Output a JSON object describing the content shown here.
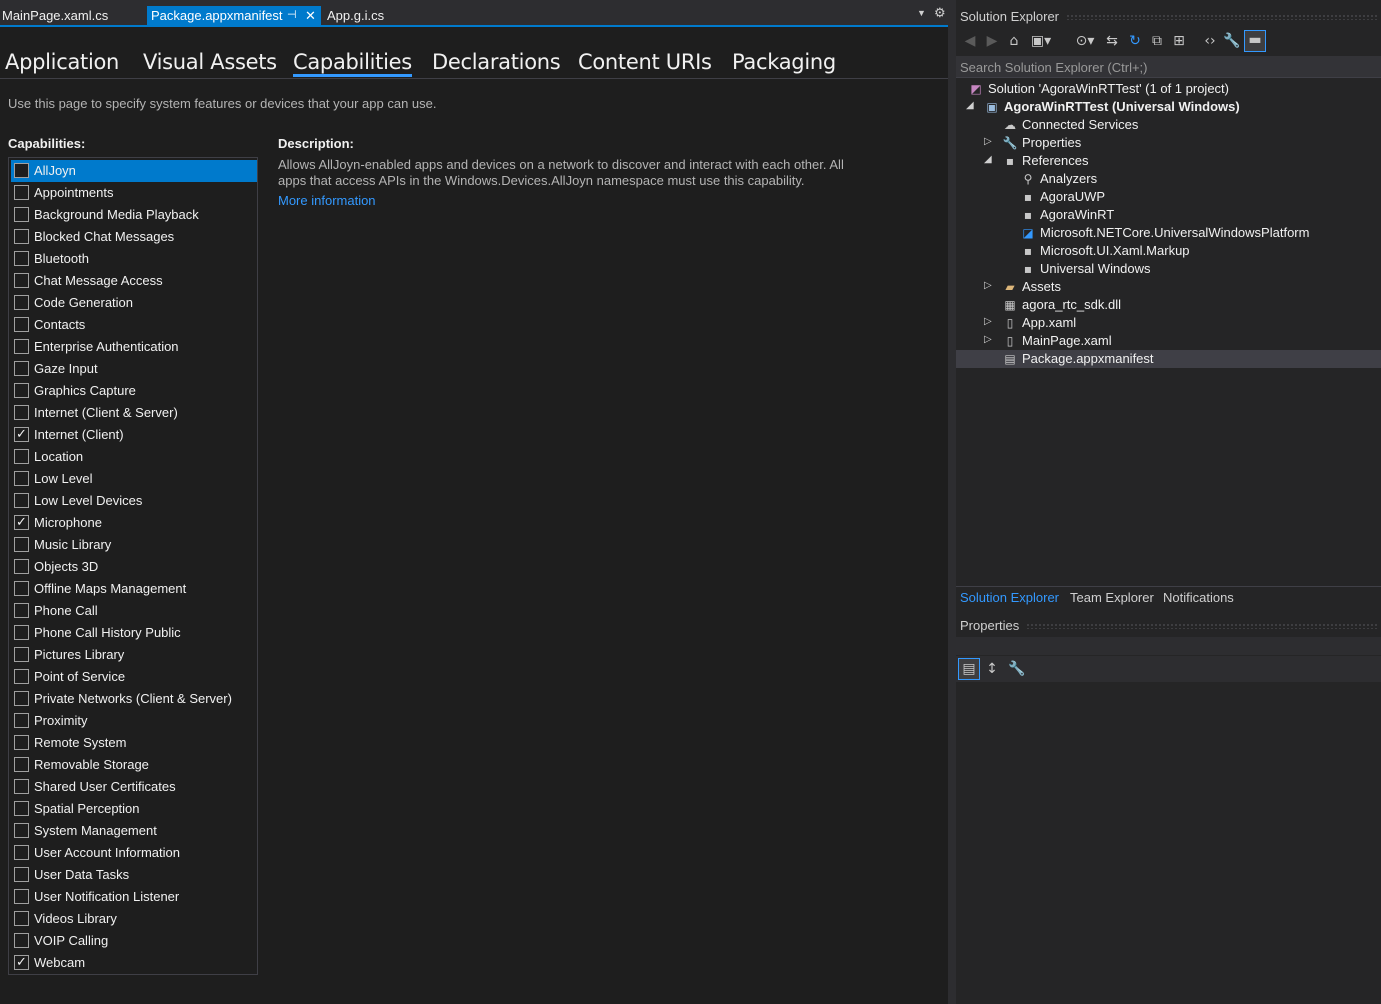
{
  "doc_tabs": [
    {
      "label": "MainPage.xaml.cs",
      "active": false
    },
    {
      "label": "Package.appxmanifest",
      "active": true
    },
    {
      "label": "App.g.i.cs",
      "active": false
    }
  ],
  "doc_tab_icons": {
    "pin": "pin-icon",
    "close": "close-icon",
    "dropdown": "chevron-down-icon",
    "settings": "gear-icon"
  },
  "manifest_tabs": [
    "Application",
    "Visual Assets",
    "Capabilities",
    "Declarations",
    "Content URIs",
    "Packaging"
  ],
  "active_manifest_tab": "Capabilities",
  "page_intro": "Use this page to specify system features or devices that your app can use.",
  "capabilities_header": "Capabilities:",
  "capabilities": [
    {
      "label": "AllJoyn",
      "checked": false,
      "selected": true
    },
    {
      "label": "Appointments",
      "checked": false
    },
    {
      "label": "Background Media Playback",
      "checked": false
    },
    {
      "label": "Blocked Chat Messages",
      "checked": false
    },
    {
      "label": "Bluetooth",
      "checked": false
    },
    {
      "label": "Chat Message Access",
      "checked": false
    },
    {
      "label": "Code Generation",
      "checked": false
    },
    {
      "label": "Contacts",
      "checked": false
    },
    {
      "label": "Enterprise Authentication",
      "checked": false
    },
    {
      "label": "Gaze Input",
      "checked": false
    },
    {
      "label": "Graphics Capture",
      "checked": false
    },
    {
      "label": "Internet (Client & Server)",
      "checked": false
    },
    {
      "label": "Internet (Client)",
      "checked": true
    },
    {
      "label": "Location",
      "checked": false
    },
    {
      "label": "Low Level",
      "checked": false
    },
    {
      "label": "Low Level Devices",
      "checked": false
    },
    {
      "label": "Microphone",
      "checked": true
    },
    {
      "label": "Music Library",
      "checked": false
    },
    {
      "label": "Objects 3D",
      "checked": false
    },
    {
      "label": "Offline Maps Management",
      "checked": false
    },
    {
      "label": "Phone Call",
      "checked": false
    },
    {
      "label": "Phone Call History Public",
      "checked": false
    },
    {
      "label": "Pictures Library",
      "checked": false
    },
    {
      "label": "Point of Service",
      "checked": false
    },
    {
      "label": "Private Networks (Client & Server)",
      "checked": false
    },
    {
      "label": "Proximity",
      "checked": false
    },
    {
      "label": "Remote System",
      "checked": false
    },
    {
      "label": "Removable Storage",
      "checked": false
    },
    {
      "label": "Shared User Certificates",
      "checked": false
    },
    {
      "label": "Spatial Perception",
      "checked": false
    },
    {
      "label": "System Management",
      "checked": false
    },
    {
      "label": "User Account Information",
      "checked": false
    },
    {
      "label": "User Data Tasks",
      "checked": false
    },
    {
      "label": "User Notification Listener",
      "checked": false
    },
    {
      "label": "Videos Library",
      "checked": false
    },
    {
      "label": "VOIP Calling",
      "checked": false
    },
    {
      "label": "Webcam",
      "checked": true
    }
  ],
  "description": {
    "header": "Description:",
    "text": "Allows AllJoyn-enabled apps and devices on a network to discover and interact with each other. All apps that access APIs in the Windows.Devices.AllJoyn namespace must use this capability.",
    "link": "More information"
  },
  "solution_explorer": {
    "title": "Solution Explorer",
    "search_placeholder": "Search Solution Explorer (Ctrl+;)",
    "toolbar_icons": [
      "back-icon",
      "forward-icon",
      "home-icon",
      "switch-views-icon",
      "pending-changes-icon",
      "sync-icon",
      "refresh-icon",
      "collapse-all-icon",
      "show-all-files-icon",
      "view-code-icon",
      "properties-icon",
      "preview-icon"
    ],
    "tree": [
      {
        "label": "Solution 'AgoraWinRTTest' (1 of 1 project)",
        "icon": "solution-icon",
        "expanded": null,
        "bold": false
      },
      {
        "label": "AgoraWinRTTest (Universal Windows)",
        "icon": "csharp-project-icon",
        "expanded": true,
        "bold": true
      },
      {
        "label": "Connected Services",
        "icon": "connected-services-icon",
        "expanded": null,
        "bold": false
      },
      {
        "label": "Properties",
        "icon": "wrench-icon",
        "expanded": false,
        "bold": false
      },
      {
        "label": "References",
        "icon": "references-icon",
        "expanded": true,
        "bold": false
      },
      {
        "label": "Analyzers",
        "icon": "analyzers-icon",
        "expanded": null,
        "bold": false
      },
      {
        "label": "AgoraUWP",
        "icon": "reference-icon",
        "expanded": null,
        "bold": false
      },
      {
        "label": "AgoraWinRT",
        "icon": "reference-icon",
        "expanded": null,
        "bold": false
      },
      {
        "label": "Microsoft.NETCore.UniversalWindowsPlatform",
        "icon": "nuget-package-icon",
        "expanded": null,
        "bold": false
      },
      {
        "label": "Microsoft.UI.Xaml.Markup",
        "icon": "reference-icon",
        "expanded": null,
        "bold": false
      },
      {
        "label": "Universal Windows",
        "icon": "reference-icon",
        "expanded": null,
        "bold": false
      },
      {
        "label": "Assets",
        "icon": "folder-icon",
        "expanded": false,
        "bold": false
      },
      {
        "label": "agora_rtc_sdk.dll",
        "icon": "dll-icon",
        "expanded": null,
        "bold": false
      },
      {
        "label": "App.xaml",
        "icon": "xaml-file-icon",
        "expanded": false,
        "bold": false
      },
      {
        "label": "MainPage.xaml",
        "icon": "xaml-file-icon",
        "expanded": false,
        "bold": false
      },
      {
        "label": "Package.appxmanifest",
        "icon": "manifest-icon",
        "expanded": null,
        "bold": false,
        "selected": true
      }
    ]
  },
  "bottom_tabs": [
    {
      "label": "Solution Explorer",
      "active": true
    },
    {
      "label": "Team Explorer",
      "active": false
    },
    {
      "label": "Notifications",
      "active": false
    }
  ],
  "properties_panel": {
    "title": "Properties",
    "toolbar_icons": [
      "categorized-icon",
      "alphabetical-icon",
      "property-pages-icon"
    ]
  },
  "colors": {
    "accent": "#007acc",
    "link": "#3399ff",
    "background": "#1e1e1e",
    "panel": "#252526"
  }
}
